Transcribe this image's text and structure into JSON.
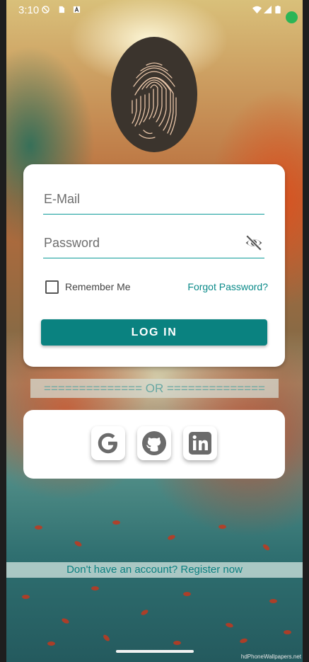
{
  "status_bar": {
    "time": "3:10"
  },
  "login": {
    "email_placeholder": "E-Mail",
    "password_placeholder": "Password",
    "remember_label": "Remember Me",
    "forgot_label": "Forgot Password?",
    "login_label": "LOG IN"
  },
  "divider": {
    "text": "============== OR =============="
  },
  "social": {
    "icons": [
      "google-icon",
      "github-icon",
      "linkedin-icon"
    ]
  },
  "register": {
    "text": "Don't have an account? Register now"
  },
  "watermark": {
    "text": "hdPhoneWallpapers.net"
  },
  "colors": {
    "accent": "#0a8280",
    "link": "#0a8a89",
    "card": "#ffffff"
  }
}
